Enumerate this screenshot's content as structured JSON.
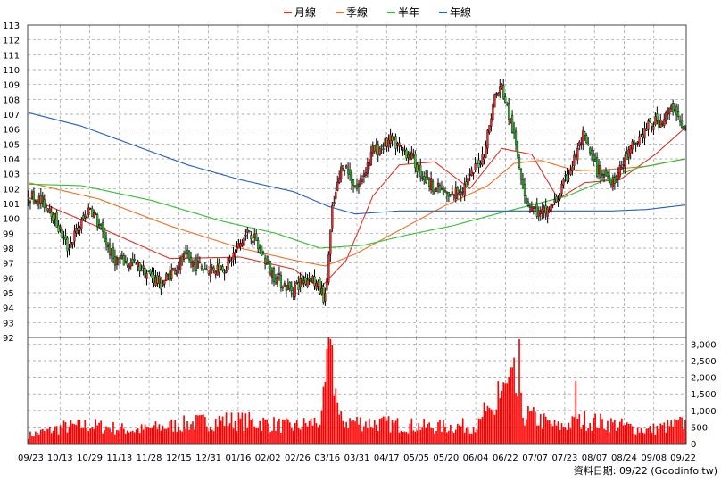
{
  "chart_data": {
    "type": "candlestick",
    "legend": [
      {
        "name": "月線",
        "color": "#e03020"
      },
      {
        "name": "季線",
        "color": "#f07020"
      },
      {
        "name": "半年",
        "color": "#30c030"
      },
      {
        "name": "年線",
        "color": "#2060c0"
      }
    ],
    "x_tick_labels": [
      "09/23",
      "10/13",
      "10/29",
      "11/13",
      "11/28",
      "12/15",
      "12/31",
      "01/16",
      "02/02",
      "02/26",
      "03/16",
      "03/31",
      "04/17",
      "05/05",
      "05/20",
      "06/04",
      "06/22",
      "07/07",
      "07/23",
      "08/07",
      "08/24",
      "09/08",
      "09/22"
    ],
    "price_axis": {
      "ylim": [
        92,
        113
      ],
      "ticks": [
        92,
        93,
        94,
        95,
        96,
        97,
        98,
        99,
        100,
        101,
        102,
        103,
        104,
        105,
        106,
        107,
        108,
        109,
        110,
        111,
        112,
        113
      ]
    },
    "volume_axis": {
      "ylim": [
        0,
        3200
      ],
      "ticks": [
        "0",
        "500",
        "1,000",
        "1,500",
        "2,000",
        "2,500",
        "3,000"
      ],
      "tick_values": [
        0,
        500,
        1000,
        1500,
        2000,
        2500,
        3000
      ]
    },
    "price_key_points": [
      {
        "x": 0,
        "close": 101.6
      },
      {
        "x": 12,
        "close": 100.8
      },
      {
        "x": 22,
        "close": 98.0
      },
      {
        "x": 35,
        "close": 100.8
      },
      {
        "x": 48,
        "close": 97.3
      },
      {
        "x": 62,
        "close": 96.8
      },
      {
        "x": 75,
        "close": 95.6
      },
      {
        "x": 88,
        "close": 97.3
      },
      {
        "x": 100,
        "close": 96.6
      },
      {
        "x": 112,
        "close": 96.8
      },
      {
        "x": 125,
        "close": 99.2
      },
      {
        "x": 138,
        "close": 96.3
      },
      {
        "x": 148,
        "close": 95.2
      },
      {
        "x": 160,
        "close": 96.1
      },
      {
        "x": 168,
        "close": 94.6
      },
      {
        "x": 172,
        "close": 100.5
      },
      {
        "x": 178,
        "close": 103.8
      },
      {
        "x": 186,
        "close": 102.0
      },
      {
        "x": 195,
        "close": 104.5
      },
      {
        "x": 205,
        "close": 105.2
      },
      {
        "x": 215,
        "close": 104.4
      },
      {
        "x": 225,
        "close": 102.6
      },
      {
        "x": 238,
        "close": 101.4
      },
      {
        "x": 248,
        "close": 102.3
      },
      {
        "x": 258,
        "close": 104.4
      },
      {
        "x": 264,
        "close": 108.2
      },
      {
        "x": 268,
        "close": 108.8
      },
      {
        "x": 274,
        "close": 106.0
      },
      {
        "x": 282,
        "close": 101.2
      },
      {
        "x": 290,
        "close": 100.2
      },
      {
        "x": 298,
        "close": 101.0
      },
      {
        "x": 306,
        "close": 103.0
      },
      {
        "x": 314,
        "close": 105.5
      },
      {
        "x": 322,
        "close": 103.2
      },
      {
        "x": 332,
        "close": 102.6
      },
      {
        "x": 342,
        "close": 104.8
      },
      {
        "x": 352,
        "close": 106.3
      },
      {
        "x": 360,
        "close": 106.7
      },
      {
        "x": 366,
        "close": 107.6
      },
      {
        "x": 370,
        "close": 106.0
      }
    ],
    "ma_series": [
      {
        "name": "月線",
        "key_points": [
          {
            "x": 0,
            "v": 101.4
          },
          {
            "x": 40,
            "v": 99.4
          },
          {
            "x": 80,
            "v": 97.3
          },
          {
            "x": 120,
            "v": 97.4
          },
          {
            "x": 150,
            "v": 96.6
          },
          {
            "x": 165,
            "v": 95.3
          },
          {
            "x": 180,
            "v": 97.2
          },
          {
            "x": 195,
            "v": 101.5
          },
          {
            "x": 210,
            "v": 103.6
          },
          {
            "x": 230,
            "v": 103.8
          },
          {
            "x": 250,
            "v": 102.0
          },
          {
            "x": 268,
            "v": 104.7
          },
          {
            "x": 285,
            "v": 104.3
          },
          {
            "x": 300,
            "v": 101.3
          },
          {
            "x": 315,
            "v": 102.4
          },
          {
            "x": 335,
            "v": 102.6
          },
          {
            "x": 355,
            "v": 104.3
          },
          {
            "x": 372,
            "v": 106.1
          }
        ]
      },
      {
        "name": "季線",
        "key_points": [
          {
            "x": 0,
            "v": 102.4
          },
          {
            "x": 40,
            "v": 101.3
          },
          {
            "x": 80,
            "v": 99.5
          },
          {
            "x": 120,
            "v": 98.0
          },
          {
            "x": 150,
            "v": 97.2
          },
          {
            "x": 168,
            "v": 96.8
          },
          {
            "x": 185,
            "v": 97.6
          },
          {
            "x": 210,
            "v": 99.2
          },
          {
            "x": 235,
            "v": 100.8
          },
          {
            "x": 260,
            "v": 102.2
          },
          {
            "x": 275,
            "v": 103.7
          },
          {
            "x": 290,
            "v": 103.9
          },
          {
            "x": 310,
            "v": 103.2
          },
          {
            "x": 330,
            "v": 103.3
          },
          {
            "x": 350,
            "v": 103.5
          },
          {
            "x": 372,
            "v": 104.0
          }
        ]
      },
      {
        "name": "半年",
        "key_points": [
          {
            "x": 0,
            "v": 102.3
          },
          {
            "x": 30,
            "v": 102.2
          },
          {
            "x": 70,
            "v": 101.2
          },
          {
            "x": 110,
            "v": 99.8
          },
          {
            "x": 140,
            "v": 99.0
          },
          {
            "x": 165,
            "v": 98.0
          },
          {
            "x": 190,
            "v": 98.2
          },
          {
            "x": 215,
            "v": 98.9
          },
          {
            "x": 240,
            "v": 99.5
          },
          {
            "x": 265,
            "v": 100.3
          },
          {
            "x": 285,
            "v": 100.9
          },
          {
            "x": 305,
            "v": 101.5
          },
          {
            "x": 325,
            "v": 102.5
          },
          {
            "x": 345,
            "v": 103.4
          },
          {
            "x": 372,
            "v": 104.0
          }
        ]
      },
      {
        "name": "年線",
        "key_points": [
          {
            "x": 0,
            "v": 107.1
          },
          {
            "x": 30,
            "v": 106.2
          },
          {
            "x": 60,
            "v": 104.9
          },
          {
            "x": 90,
            "v": 103.6
          },
          {
            "x": 120,
            "v": 102.6
          },
          {
            "x": 150,
            "v": 101.8
          },
          {
            "x": 170,
            "v": 100.8
          },
          {
            "x": 185,
            "v": 100.3
          },
          {
            "x": 210,
            "v": 100.5
          },
          {
            "x": 240,
            "v": 100.5
          },
          {
            "x": 270,
            "v": 100.5
          },
          {
            "x": 300,
            "v": 100.5
          },
          {
            "x": 330,
            "v": 100.5
          },
          {
            "x": 350,
            "v": 100.6
          },
          {
            "x": 372,
            "v": 100.9
          }
        ]
      }
    ],
    "volume_key_points": [
      {
        "x": 0,
        "v": 250
      },
      {
        "x": 20,
        "v": 500
      },
      {
        "x": 35,
        "v": 550
      },
      {
        "x": 60,
        "v": 400
      },
      {
        "x": 90,
        "v": 600
      },
      {
        "x": 110,
        "v": 700
      },
      {
        "x": 130,
        "v": 650
      },
      {
        "x": 150,
        "v": 500
      },
      {
        "x": 166,
        "v": 700
      },
      {
        "x": 171,
        "v": 3100
      },
      {
        "x": 176,
        "v": 700
      },
      {
        "x": 200,
        "v": 600
      },
      {
        "x": 230,
        "v": 500
      },
      {
        "x": 255,
        "v": 550
      },
      {
        "x": 264,
        "v": 1000
      },
      {
        "x": 268,
        "v": 1500
      },
      {
        "x": 275,
        "v": 1800
      },
      {
        "x": 280,
        "v": 900
      },
      {
        "x": 300,
        "v": 500
      },
      {
        "x": 315,
        "v": 700
      },
      {
        "x": 330,
        "v": 600
      },
      {
        "x": 350,
        "v": 400
      },
      {
        "x": 370,
        "v": 600
      }
    ],
    "volume_spikes": [
      {
        "x": 171,
        "v": 3150
      },
      {
        "x": 278,
        "v": 3150
      },
      {
        "x": 266,
        "v": 1880
      },
      {
        "x": 310,
        "v": 1880
      },
      {
        "x": 258,
        "v": 1250
      }
    ],
    "xlabel": "",
    "ylabel": ""
  },
  "footer": {
    "source_text": "資料日期: 09/22  (Goodinfo.tw)"
  }
}
